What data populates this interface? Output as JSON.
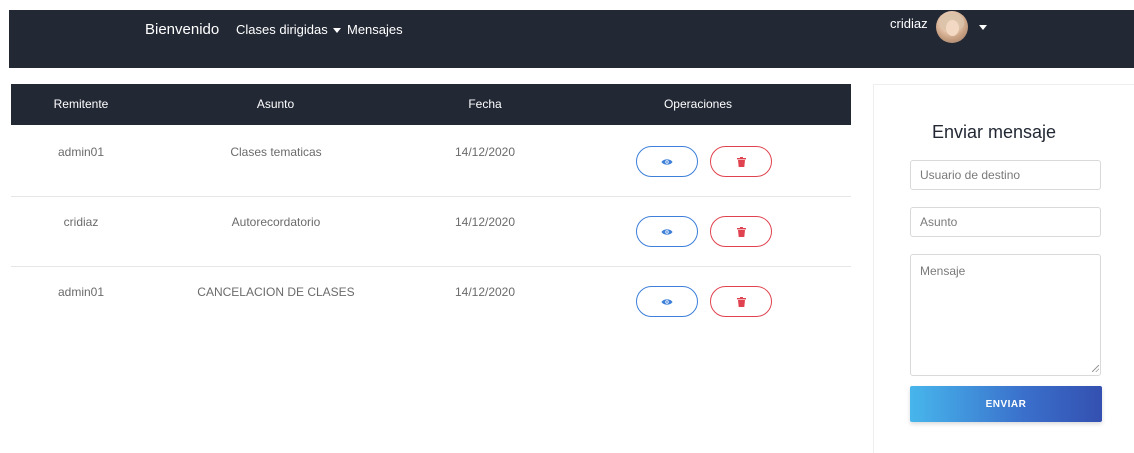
{
  "navbar": {
    "brand": "Bienvenido",
    "classes_menu": "Clases dirigidas",
    "messages_link": "Mensajes",
    "username": "cridiaz"
  },
  "table": {
    "headers": [
      "Remitente",
      "Asunto",
      "Fecha",
      "Operaciones"
    ],
    "rows": [
      {
        "sender": "admin01",
        "subject": "Clases tematicas",
        "date": "14/12/2020"
      },
      {
        "sender": "cridiaz",
        "subject": "Autorecordatorio",
        "date": "14/12/2020"
      },
      {
        "sender": "admin01",
        "subject": "CANCELACION DE CLASES",
        "date": "14/12/2020"
      }
    ],
    "operations": [
      "eye-icon",
      "trash-icon"
    ]
  },
  "compose": {
    "title": "Enviar mensaje",
    "recipient_placeholder": "Usuario de destino",
    "subject_placeholder": "Asunto",
    "message_placeholder": "Mensaje",
    "send_label": "ENVIAR"
  },
  "colors": {
    "navbar_bg": "#222834",
    "view_button": "#3d7fd9",
    "delete_button": "#e0434f"
  }
}
